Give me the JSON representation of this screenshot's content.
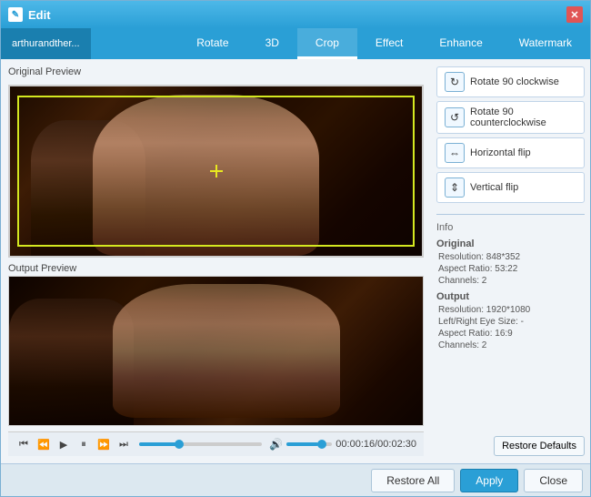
{
  "window": {
    "title": "Edit",
    "icon": "✎"
  },
  "file_tab": {
    "label": "arthurandther..."
  },
  "tabs": [
    {
      "id": "rotate",
      "label": "Rotate",
      "active": false
    },
    {
      "id": "3d",
      "label": "3D",
      "active": false
    },
    {
      "id": "crop",
      "label": "Crop",
      "active": true
    },
    {
      "id": "effect",
      "label": "Effect",
      "active": false
    },
    {
      "id": "enhance",
      "label": "Enhance",
      "active": false
    },
    {
      "id": "watermark",
      "label": "Watermark",
      "active": false
    }
  ],
  "previews": {
    "original_label": "Original Preview",
    "output_label": "Output Preview"
  },
  "actions": [
    {
      "id": "rotate-cw",
      "label": "Rotate 90 clockwise",
      "icon": "↻"
    },
    {
      "id": "rotate-ccw",
      "label": "Rotate 90 counterclockwise",
      "icon": "↺"
    },
    {
      "id": "flip-h",
      "label": "Horizontal flip",
      "icon": "⇔"
    },
    {
      "id": "flip-v",
      "label": "Vertical flip",
      "icon": "⇕"
    }
  ],
  "info": {
    "section_title": "Info",
    "original_label": "Original",
    "original_resolution": "Resolution: 848*352",
    "original_aspect": "Aspect Ratio: 53:22",
    "original_channels": "Channels: 2",
    "output_label": "Output",
    "output_resolution": "Resolution: 1920*1080",
    "output_lr_size": "Left/Right Eye Size: -",
    "output_aspect": "Aspect Ratio: 16:9",
    "output_channels": "Channels: 2"
  },
  "playback": {
    "time": "00:00:16/00:02:30"
  },
  "buttons": {
    "restore_defaults": "Restore Defaults",
    "restore_all": "Restore All",
    "apply": "Apply",
    "close": "Close"
  }
}
